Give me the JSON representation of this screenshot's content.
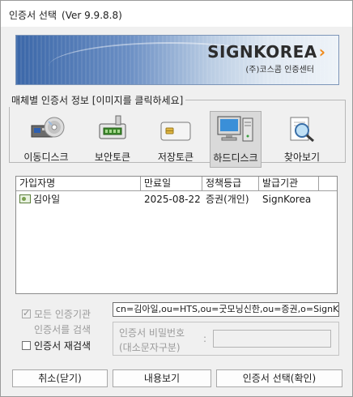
{
  "window": {
    "title": "인증서 선택",
    "version": "(Ver 9.9.8.8)"
  },
  "banner": {
    "logo_text": "SIGNKOREA",
    "logo_arrow": "›",
    "logo_subtitle": "(주)코스콤 인증센터"
  },
  "media": {
    "legend": "매체별 인증서 정보 [이미지를 클릭하세요]",
    "items": [
      {
        "label": "이동디스크",
        "icon": "removable-disk-icon",
        "selected": false
      },
      {
        "label": "보안토큰",
        "icon": "security-token-icon",
        "selected": false
      },
      {
        "label": "저장토큰",
        "icon": "storage-token-icon",
        "selected": false
      },
      {
        "label": "하드디스크",
        "icon": "hard-disk-icon",
        "selected": true
      },
      {
        "label": "찾아보기",
        "icon": "browse-icon",
        "selected": false
      }
    ]
  },
  "cert_table": {
    "columns": [
      "가입자명",
      "만료일",
      "정책등급",
      "발급기관"
    ],
    "rows": [
      {
        "name": "김아일",
        "expiry": "2025-08-22",
        "policy": "증권(개인)",
        "issuer": "SignKorea"
      }
    ]
  },
  "options": {
    "search_all_line1": "모든 인증기관",
    "search_all_line2": "인증서를 검색",
    "search_all_checked": true,
    "search_all_disabled": true,
    "research_label": "인증서 재검색",
    "research_checked": false
  },
  "dn_text": "cn=김아일,ou=HTS,ou=굿모닝신한,ou=증권,o=SignKorea,c=KR",
  "password": {
    "label_line1": "인증서 비밀번호",
    "label_line2": "(대소문자구분)",
    "colon": ":",
    "value": ""
  },
  "buttons": {
    "cancel": "취소(닫기)",
    "view": "내용보기",
    "confirm": "인증서 선택(확인)"
  }
}
